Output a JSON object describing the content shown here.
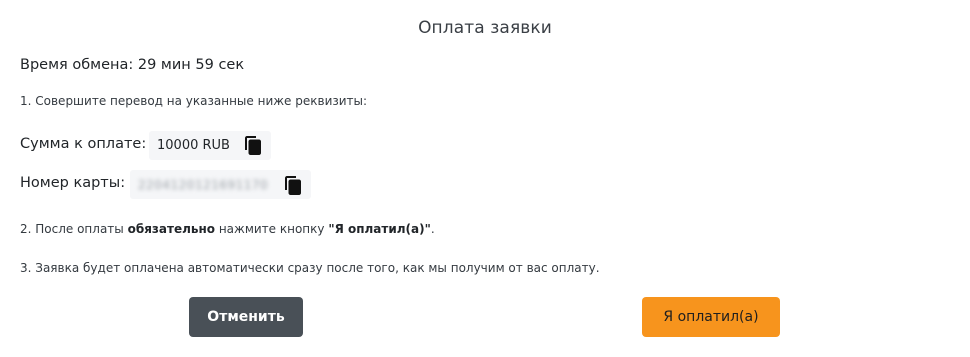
{
  "modal": {
    "title": "Оплата заявки",
    "timer_text": "Время обмена: 29 мин 59 сек"
  },
  "steps": {
    "step1": "1. Совершите перевод на указанные ниже реквизиты:",
    "step2_prefix": "2. После оплаты ",
    "step2_bold1": "обязательно",
    "step2_middle": " нажмите кнопку ",
    "step2_bold2": "\"Я оплатил(а)\"",
    "step2_suffix": ".",
    "step3": "3. Заявка будет оплачена автоматически сразу после того, как мы получим от вас оплату."
  },
  "payment": {
    "amount_label": "Сумма к оплате:",
    "amount_value": "10000 RUB",
    "card_label": "Номер карты:",
    "card_value": "2204120121691170"
  },
  "buttons": {
    "cancel_label": "Отменить",
    "paid_label": "Я оплатил(а)"
  },
  "icons": {
    "copy": "copy-icon"
  },
  "colors": {
    "cancel_bg": "#495057",
    "paid_bg": "#f7941d",
    "value_bg": "#f5f6f8"
  }
}
